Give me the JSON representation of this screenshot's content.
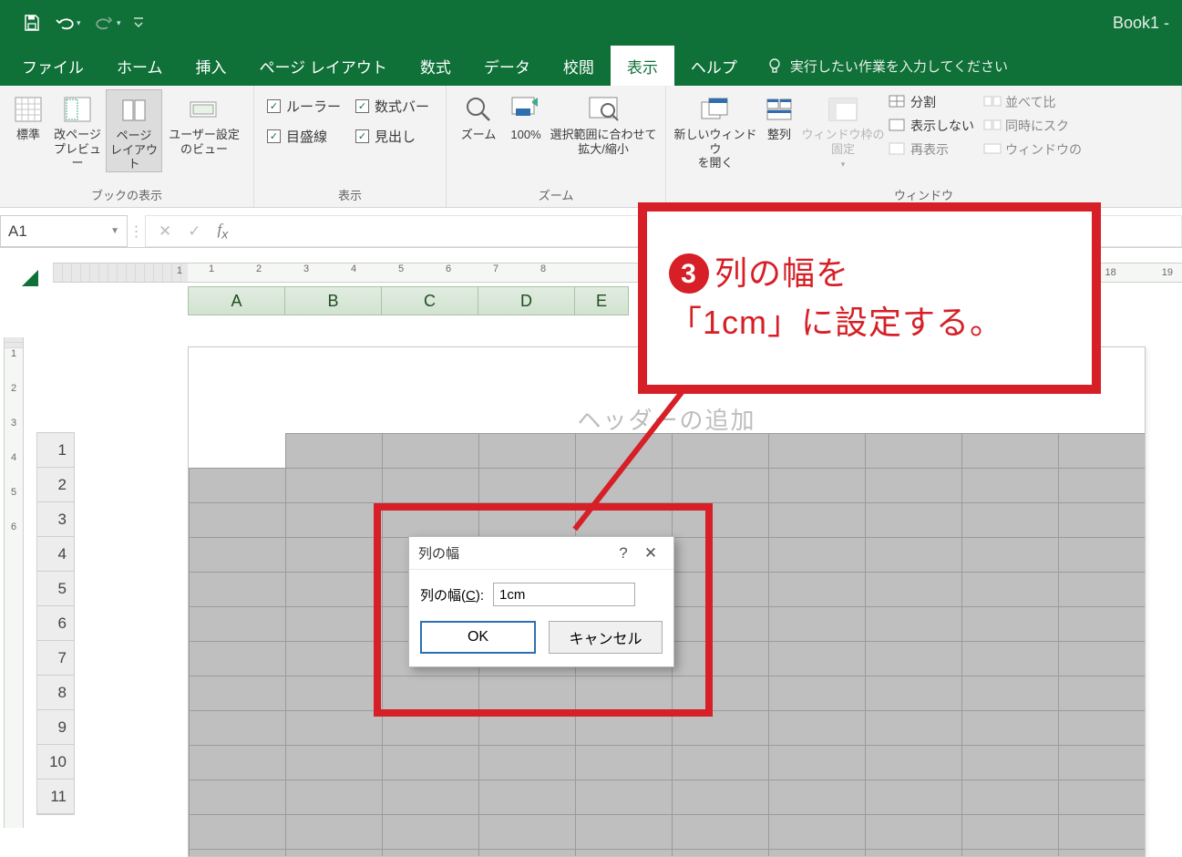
{
  "title_bar": {
    "workbook_name": "Book1  -"
  },
  "tabs": {
    "file": "ファイル",
    "home": "ホーム",
    "insert": "挿入",
    "page_layout": "ページ レイアウト",
    "formulas": "数式",
    "data": "データ",
    "review": "校閲",
    "view": "表示",
    "help": "ヘルプ",
    "tell_me": "実行したい作業を入力してください"
  },
  "ribbon": {
    "workbook_views": {
      "normal": "標準",
      "page_break": "改ページ\nプレビュー",
      "page_layout": "ページ\nレイアウト",
      "custom_views": "ユーザー設定\nのビュー",
      "group_label": "ブックの表示"
    },
    "show": {
      "ruler": "ルーラー",
      "formula_bar": "数式バー",
      "gridlines": "目盛線",
      "headings": "見出し",
      "group_label": "表示"
    },
    "zoom": {
      "zoom": "ズーム",
      "hundred": "100%",
      "fit_selection": "選択範囲に合わせて\n拡大/縮小",
      "group_label": "ズーム"
    },
    "window": {
      "new_window": "新しいウィンドウ\nを開く",
      "arrange": "整列",
      "freeze": "ウィンドウ枠の\n固定",
      "split": "分割",
      "hide": "表示しない",
      "unhide": "再表示",
      "side_by_side": "並べて比",
      "sync_scroll": "同時にスク",
      "reset_pos": "ウィンドウの",
      "group_label": "ウィンドウ"
    }
  },
  "formula_bar": {
    "cell_ref": "A1"
  },
  "ruler": {
    "h": [
      "1",
      "2",
      "3",
      "4",
      "5",
      "6",
      "7",
      "8"
    ],
    "h_far": [
      "18",
      "19"
    ],
    "v": [
      "1",
      "2",
      "3",
      "4",
      "5",
      "6"
    ],
    "margin_left_tick": "1"
  },
  "columns": [
    "A",
    "B",
    "C",
    "D",
    "E"
  ],
  "rows": [
    "1",
    "2",
    "3",
    "4",
    "5",
    "6",
    "7",
    "8",
    "9",
    "10",
    "11"
  ],
  "page_header_placeholder": "ヘッダーの追加",
  "dialog": {
    "title": "列の幅",
    "label_prefix": "列の幅(",
    "label_accel": "C",
    "label_suffix": "):",
    "value": "1cm",
    "ok": "OK",
    "cancel": "キャンセル"
  },
  "annotation": {
    "number": "3",
    "line1": "列の幅を",
    "line2": "「1cm」に設定する。"
  }
}
